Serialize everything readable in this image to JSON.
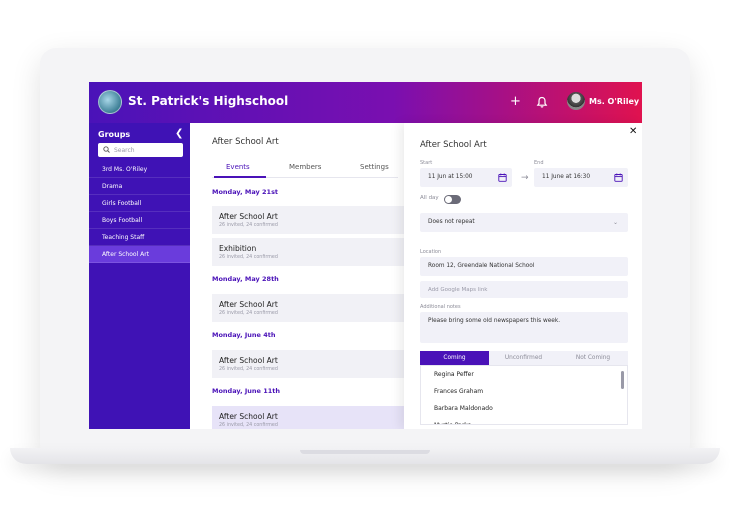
{
  "app": {
    "title": "St. Patrick's Highschool",
    "add_icon": "plus-icon",
    "notifications_icon": "bell-icon",
    "user_name": "Ms. O'Riley",
    "logo_icon": "school-logo"
  },
  "sidebar": {
    "title": "Groups",
    "collapse_icon": "chevron-left-icon",
    "search_placeholder": "Search",
    "items": [
      {
        "label": "3rd Ms. O'Riley"
      },
      {
        "label": "Drama"
      },
      {
        "label": "Girls Football"
      },
      {
        "label": "Boys Football"
      },
      {
        "label": "Teaching Staff"
      },
      {
        "label": "After School Art",
        "active": true
      }
    ]
  },
  "group": {
    "title": "After School Art",
    "tabs": [
      "Events",
      "Members",
      "Settings"
    ],
    "active_tab": "Events",
    "dates": [
      "Monday, May 21st",
      "Monday, May 28th",
      "Monday, June 4th",
      "Monday, June 11th"
    ],
    "events": [
      {
        "name": "After School Art",
        "stats": "26 invited, 24 confirmed"
      },
      {
        "name": "Exhibition",
        "stats": "26 invited, 24 confirmed"
      },
      {
        "name": "After School Art",
        "stats": "26 invited, 24 confirmed"
      },
      {
        "name": "After School Art",
        "stats": "26 invited, 24 confirmed"
      },
      {
        "name": "After School Art",
        "stats": "26 invited, 24 confirmed"
      }
    ]
  },
  "detail": {
    "title": "After School Art",
    "close_icon": "close-icon",
    "start_label": "Start",
    "start_value": "11 Jun at 15:00",
    "end_label": "End",
    "end_value": "11 June at 16:30",
    "calendar_icon": "calendar-icon",
    "arrow_icon": "arrow-right-icon",
    "allday_label": "All day",
    "allday_on": false,
    "repeat_value": "Does not repeat",
    "location_label": "Location",
    "location_value": "Room 12, Greendale National School",
    "maps_placeholder": "Add Google Maps link",
    "notes_label": "Additional notes",
    "notes_value": "Please bring some old newspapers this week.",
    "rsvp_tabs": [
      "Coming",
      "Unconfirmed",
      "Not Coming"
    ],
    "active_rsvp": "Coming",
    "attendees": [
      "Regina Peffer",
      "Frances Graham",
      "Barbara Maldonado",
      "Myrtie Parks"
    ]
  },
  "colors": {
    "accent": "#4a12b8",
    "sidebar": "#3f12b5",
    "gradient_end": "#e0124f",
    "selected_row": "#e7e3f8"
  }
}
